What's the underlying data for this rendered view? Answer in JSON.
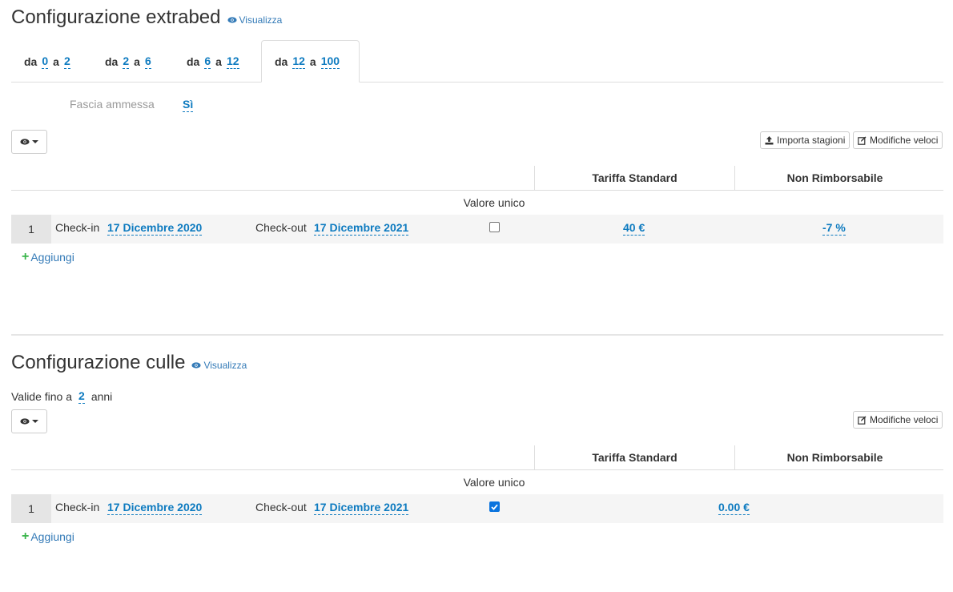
{
  "extrabed": {
    "title": "Configurazione extrabed",
    "view_link": "Visualizza",
    "tabs": [
      {
        "from_label": "da",
        "from": "0",
        "to_label": "a",
        "to": "2"
      },
      {
        "from_label": "da",
        "from": "2",
        "to_label": "a",
        "to": "6"
      },
      {
        "from_label": "da",
        "from": "6",
        "to_label": "a",
        "to": "12"
      },
      {
        "from_label": "da",
        "from": "12",
        "to_label": "a",
        "to": "100"
      }
    ],
    "active_tab": 3,
    "fascia_label": "Fascia ammessa",
    "fascia_value": "Sì",
    "import_button": "Importa stagioni",
    "quick_edit_button": "Modifiche veloci",
    "columns": [
      "Tariffa Standard",
      "Non Rimborsabile"
    ],
    "single_value": "Valore unico",
    "row": {
      "index": "1",
      "checkin_label": "Check-in",
      "checkin": "17 Dicembre 2020",
      "checkout_label": "Check-out",
      "checkout": "17 Dicembre 2021",
      "checked": false,
      "standard": "40 €",
      "non_refundable": "-7 %"
    },
    "add_link": "Aggiungi"
  },
  "cribs": {
    "title": "Configurazione culle",
    "view_link": "Visualizza",
    "valid_label": "Valide fino a",
    "valid_value": "2",
    "valid_unit": "anni",
    "quick_edit_button": "Modifiche veloci",
    "columns": [
      "Tariffa Standard",
      "Non Rimborsabile"
    ],
    "single_value": "Valore unico",
    "row": {
      "index": "1",
      "checkin_label": "Check-in",
      "checkin": "17 Dicembre 2020",
      "checkout_label": "Check-out",
      "checkout": "17 Dicembre 2021",
      "checked": true,
      "value": "0.00 €"
    },
    "add_link": "Aggiungi"
  },
  "icons": {
    "eye": "eye-icon",
    "upload": "upload-icon",
    "edit": "edit-icon",
    "plus": "plus-icon",
    "caret": "caret-down-icon",
    "check": "check-icon"
  },
  "colors": {
    "link": "#0e7bc0",
    "plus": "#39b54a",
    "checkbox_on": "#0b74de"
  }
}
